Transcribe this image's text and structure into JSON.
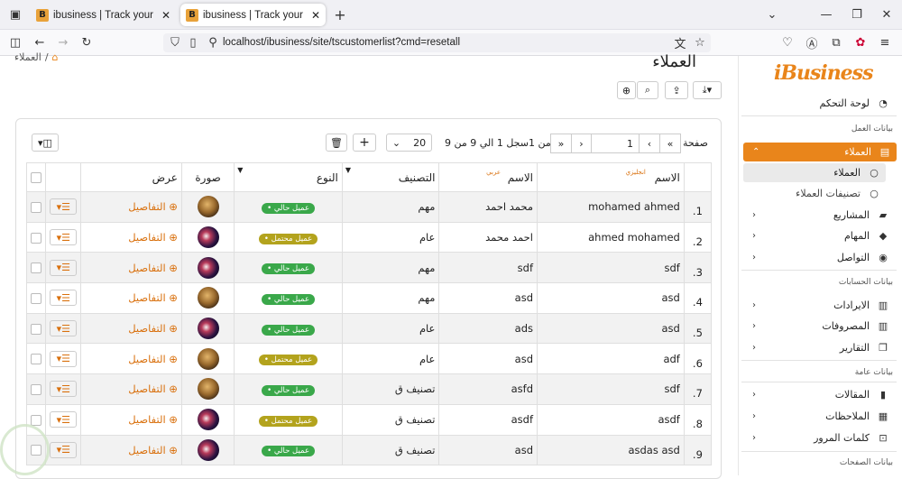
{
  "browser": {
    "tabs": [
      {
        "title": "ibusiness | Track your work with"
      },
      {
        "title": "ibusiness | Track your work with"
      }
    ],
    "url": "localhost/ibusiness/site/tscustomerlist?cmd=resetall"
  },
  "header": {
    "title": "العملاء",
    "breadcrumb": "العملاء"
  },
  "sidebar": {
    "brand": "iBusiness",
    "dashboard": "لوحة التحكم",
    "section_work": "بيانات العمل",
    "customers": "العملاء",
    "customers_sub": [
      "العملاء",
      "تصنيفات العملاء"
    ],
    "projects": "المشاريع",
    "tasks": "المهام",
    "contact": "التواصل",
    "section_accounts": "بيانات الحسابات",
    "revenues": "الايرادات",
    "expenses": "المصروفات",
    "reports": "التقارير",
    "section_general": "بيانات عامة",
    "articles": "المقالات",
    "notes": "الملاحظات",
    "passwords": "كلمات المرور",
    "section_pages": "بيانات الصفحات"
  },
  "pager": {
    "page_label": "صفحة",
    "page_value": "1",
    "of_label": "من 1",
    "records": "سجل 1 الي 9 من 9",
    "page_size": "20"
  },
  "table": {
    "columns": {
      "name_en": "الاسم",
      "name_en_sup": "انجليزي",
      "name_ar": "الاسم",
      "name_ar_sup": "عربي",
      "classification": "التصنيف",
      "type": "النوع",
      "image": "صورة",
      "view": "عرض"
    },
    "rows": [
      {
        "n": "1.",
        "en": "mohamed ahmed",
        "ar": "محمد احمد",
        "cls": "مهم",
        "type": "عميل حالي",
        "kind": "cur",
        "av": "1",
        "view": "التفاصيل"
      },
      {
        "n": "2.",
        "en": "ahmed mohamed",
        "ar": "احمد محمد",
        "cls": "عام",
        "type": "عميل محتمل",
        "kind": "pot",
        "av": "2",
        "view": "التفاصيل"
      },
      {
        "n": "3.",
        "en": "sdf",
        "ar": "sdf",
        "cls": "مهم",
        "type": "عميل حالي",
        "kind": "cur",
        "av": "2",
        "view": "التفاصيل"
      },
      {
        "n": "4.",
        "en": "asd",
        "ar": "asd",
        "cls": "مهم",
        "type": "عميل حالي",
        "kind": "cur",
        "av": "1",
        "view": "التفاصيل"
      },
      {
        "n": "5.",
        "en": "asd",
        "ar": "ads",
        "cls": "عام",
        "type": "عميل حالي",
        "kind": "cur",
        "av": "2",
        "view": "التفاصيل"
      },
      {
        "n": "6.",
        "en": "adf",
        "ar": "asd",
        "cls": "عام",
        "type": "عميل محتمل",
        "kind": "pot",
        "av": "1",
        "view": "التفاصيل"
      },
      {
        "n": "7.",
        "en": "sdf",
        "ar": "asfd",
        "cls": "تصنيف ق",
        "type": "عميل حالي",
        "kind": "cur",
        "av": "1",
        "view": "التفاصيل"
      },
      {
        "n": "8.",
        "en": "asdf",
        "ar": "asdf",
        "cls": "تصنيف ق",
        "type": "عميل محتمل",
        "kind": "pot",
        "av": "2",
        "view": "التفاصيل"
      },
      {
        "n": "9.",
        "en": "asdas asd",
        "ar": "asd",
        "cls": "تصنيف ق",
        "type": "عميل حالي",
        "kind": "cur",
        "av": "2",
        "view": "التفاصيل"
      }
    ]
  },
  "colors": {
    "accent": "#e9851b",
    "current_badge": "#3aa84a",
    "potential_badge": "#b3a31d"
  }
}
